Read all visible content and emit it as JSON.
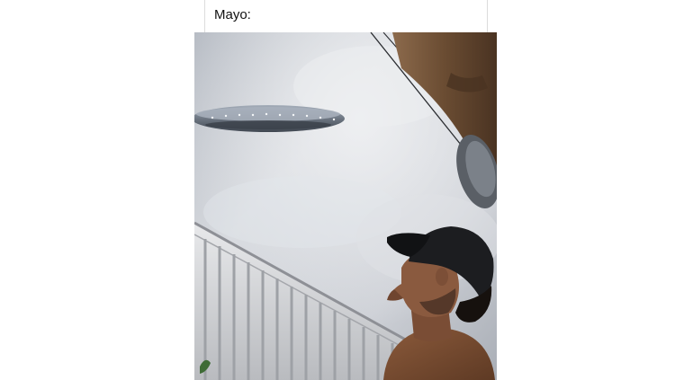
{
  "post": {
    "caption": "Mayo:"
  },
  "photo": {
    "alt": "",
    "colors": {
      "sky_light": "#e7e9ec",
      "sky_mid": "#c8ccd2",
      "sky_dark": "#9aa0a8",
      "ufo_top": "#8c96a3",
      "ufo_rim": "#5b6470",
      "pipe": "#6a4c32",
      "railing": "#d9dadc",
      "cap": "#1c1d20",
      "skin": "#8a5a3f",
      "shirt": "#7a4f33"
    }
  }
}
